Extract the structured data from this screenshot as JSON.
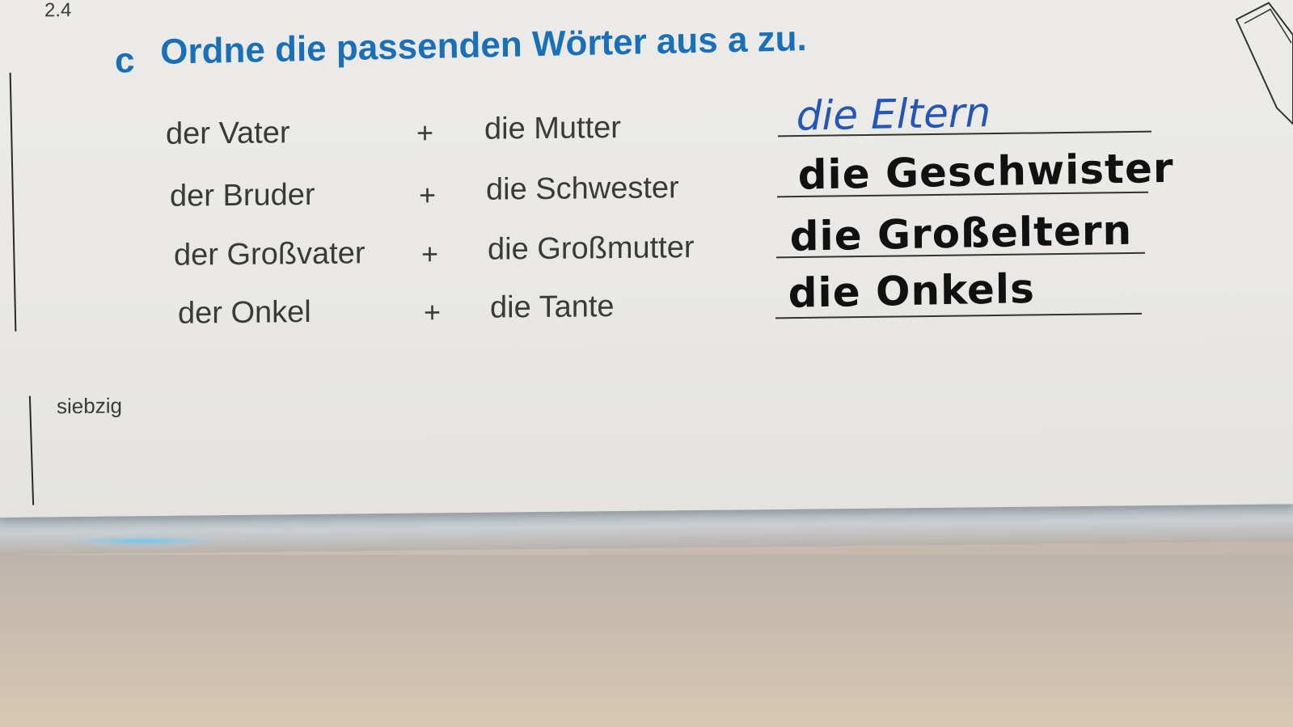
{
  "section_number": "2.4",
  "task": {
    "letter": "c",
    "title": "Ordne die passenden Wörter aus a zu."
  },
  "rows": [
    {
      "male": "der Vater",
      "plus": "+",
      "female": "die Mutter",
      "answer": "die Eltern",
      "answer_color": "#2456b8"
    },
    {
      "male": "der Bruder",
      "plus": "+",
      "female": "die Schwester",
      "answer": "die Geschwister",
      "answer_color": "#111111"
    },
    {
      "male": "der Großvater",
      "plus": "+",
      "female": "die Großmutter",
      "answer": "die Großeltern",
      "answer_color": "#111111"
    },
    {
      "male": "der Onkel",
      "plus": "+",
      "female": "die Tante",
      "answer": "die Onkels",
      "answer_color": "#111111"
    }
  ],
  "page_number_word": "siebzig",
  "colors": {
    "heading": "#1a70b8",
    "print_text": "#3a3a3a"
  }
}
